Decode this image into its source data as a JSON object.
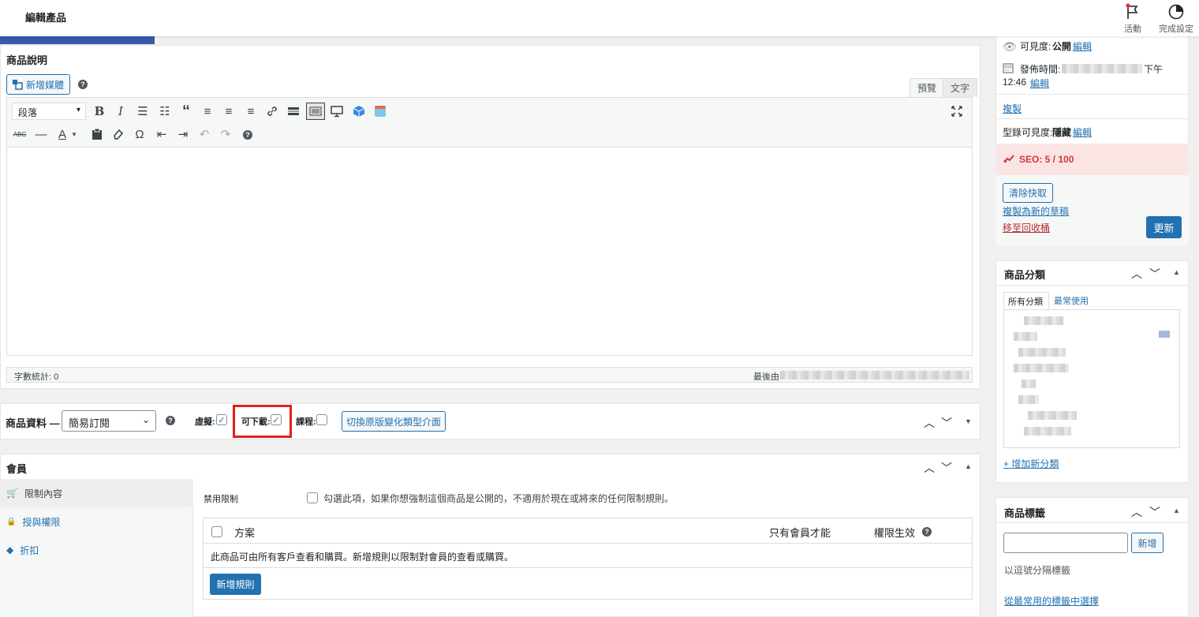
{
  "header": {
    "title": "編輯產品",
    "activity_label": "活動",
    "setup_label": "完成設定"
  },
  "description": {
    "title": "商品說明",
    "add_media": "新增媒體",
    "tab_visual": "預覽",
    "tab_text": "文字",
    "format_select": "段落",
    "word_count": "字數統計: 0",
    "last_edited": "最後由"
  },
  "product_data": {
    "label": "商品資料 —",
    "type_value": "簡易訂閱",
    "virtual_label": "虛擬:",
    "downloadable_label": "可下載:",
    "course_label": "課程:",
    "switch_button": "切換原版變化類型介面"
  },
  "membership": {
    "title": "會員",
    "tabs": [
      {
        "label": "限制內容",
        "icon": "cart-icon"
      },
      {
        "label": "授與權限",
        "icon": "lock-icon"
      },
      {
        "label": "折扣",
        "icon": "tag-icon"
      }
    ],
    "disable_label": "禁用限制",
    "disable_desc": "勾選此項，如果你想強制這個商品是公開的，不適用於現在或將來的任何限制規則。",
    "col_plan": "方案",
    "col_members_only": "只有會員才能",
    "col_access": "權限生效",
    "notice": "此商品可由所有客戶查看和購買。新增規則以限制對會員的查看或購買。",
    "add_rule": "新增規則"
  },
  "publish": {
    "visibility_label": "可見度:",
    "visibility_value": "公開",
    "edit": "編輯",
    "publish_label": "發佈時間:",
    "publish_suffix": "下午",
    "publish_time": "12:46",
    "copy": "複製",
    "catalog_label": "型錄可見度:",
    "catalog_value": "隱藏",
    "seo": "SEO: 5 / 100",
    "clear_cache": "清除快取",
    "copy_draft": "複製為新的草稿",
    "trash": "移至回收桶",
    "update": "更新"
  },
  "categories": {
    "title": "商品分類",
    "tab_all": "所有分類",
    "tab_popular": "最常使用",
    "add_new": "+ 增加新分類"
  },
  "tags": {
    "title": "商品標籤",
    "add_button": "新增",
    "hint": "以逗號分隔標籤",
    "choose": "從最常用的標籤中選擇"
  },
  "colors": {
    "primary": "#2271b1",
    "highlight": "#e1201b",
    "seo_bg": "#fbe4e4"
  }
}
